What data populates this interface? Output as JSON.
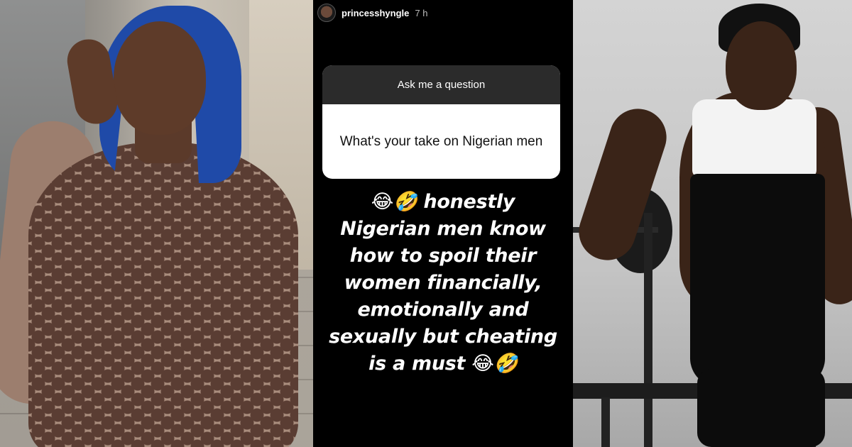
{
  "story": {
    "username": "princesshyngle",
    "time": "7 h",
    "question_header": "Ask me a question",
    "question_text": "What's your take on Nigerian men",
    "answer_lines": [
      "😂🤣 honestly",
      "Nigerian men know",
      "how to spoil their",
      "women financially,",
      "emotionally and",
      "sexually but cheating",
      "is a must 😂🤣"
    ]
  },
  "photos": {
    "left": "woman-blue-bob-snakeskin-dress",
    "right": "woman-shapewear-gym-bench"
  },
  "colors": {
    "story_bg": "#000000",
    "question_header_bg": "#2b2b2b",
    "question_body_bg": "#ffffff",
    "hair_blue": "#1f4aa8"
  }
}
